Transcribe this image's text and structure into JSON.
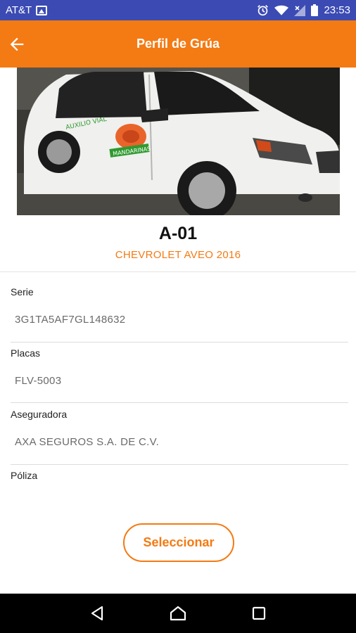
{
  "status_bar": {
    "carrier": "AT&T",
    "time": "23:53",
    "icons": [
      "image-icon",
      "alarm-icon",
      "wifi-icon",
      "signal-icon",
      "battery-icon"
    ]
  },
  "app_bar": {
    "title": "Perfil de Grúa",
    "back_icon": "arrow-left-icon",
    "color": "#f47a13"
  },
  "photo": {
    "door_text_1": "AUXILIO VIAL",
    "door_text_2": "MANDARINAS"
  },
  "truck": {
    "name": "A-01",
    "model": "CHEVROLET AVEO 2016"
  },
  "fields": [
    {
      "label": "Serie",
      "value": "3G1TA5AF7GL148632"
    },
    {
      "label": "Placas",
      "value": "FLV-5003"
    },
    {
      "label": "Aseguradora",
      "value": "AXA SEGUROS S.A. DE C.V."
    },
    {
      "label": "Póliza",
      "value": ""
    }
  ],
  "actions": {
    "select_label": "Seleccionar"
  },
  "nav": {
    "icons": [
      "back-triangle-icon",
      "home-icon",
      "recents-square-icon"
    ]
  }
}
